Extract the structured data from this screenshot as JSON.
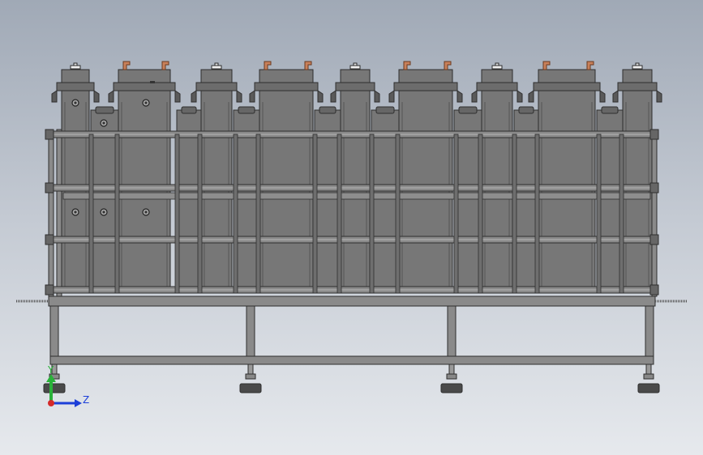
{
  "viewport": {
    "background_top": "#a0a9b6",
    "background_bottom": "#e6e9ed"
  },
  "model": {
    "body_color": "#777777",
    "rail_color": "#8a8a8a",
    "dark_color": "#4a4a4a",
    "outline_color": "#2e2e2e",
    "terminal_color": "#c8805a",
    "module_count": 9
  },
  "triad": {
    "y_label": "Y",
    "z_label": "Z",
    "y_color": "#2ab23a",
    "z_color": "#1c3fd8",
    "origin_color": "#d42a2a"
  }
}
